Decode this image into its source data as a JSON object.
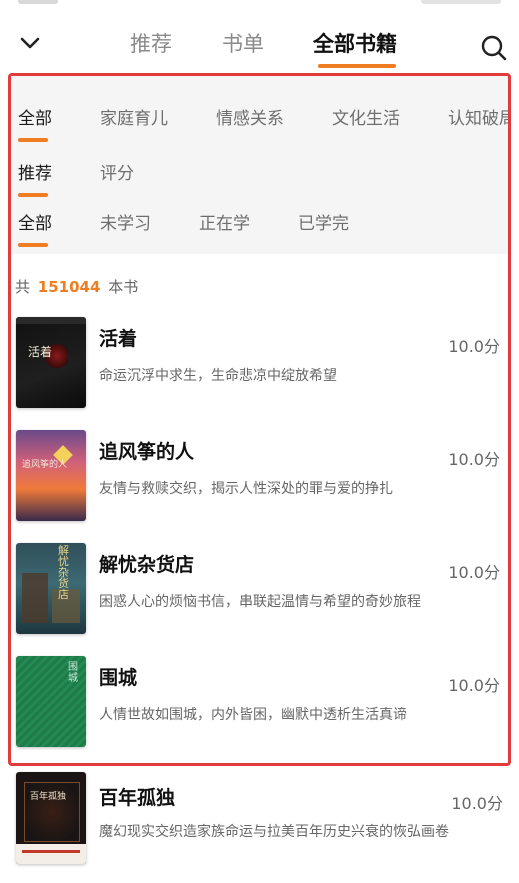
{
  "nav": {
    "tabs": [
      "推荐",
      "书单",
      "全部书籍"
    ],
    "active_tab": 2
  },
  "filters": {
    "category": [
      "全部",
      "家庭育儿",
      "情感关系",
      "文化生活",
      "认知破局"
    ],
    "sort": [
      "推荐",
      "评分"
    ],
    "progress": [
      "全部",
      "未学习",
      "正在学",
      "已学完"
    ]
  },
  "count": {
    "prefix": "共",
    "total": "151044",
    "suffix": "本书"
  },
  "books": [
    {
      "title": "活着",
      "desc": "命运沉浮中求生，生命悲凉中绽放希望",
      "score": "10.0分",
      "cover_text": "活着"
    },
    {
      "title": "追风筝的人",
      "desc": "友情与救赎交织，揭示人性深处的罪与爱的挣扎",
      "score": "10.0分",
      "cover_text": "追风筝的人"
    },
    {
      "title": "解忧杂货店",
      "desc": "困惑人心的烦恼书信，串联起温情与希望的奇妙旅程",
      "score": "10.0分",
      "cover_text": "解忧杂货店"
    },
    {
      "title": "围城",
      "desc": "人情世故如围城，内外皆困，幽默中透析生活真谛",
      "score": "10.0分",
      "cover_text": "围城"
    },
    {
      "title": "百年孤独",
      "desc": "魔幻现实交织造家族命运与拉美百年历史兴衰的恢弘画卷",
      "score": "10.0分",
      "cover_text": "百年孤独"
    }
  ],
  "colors": {
    "accent": "#ef7d21",
    "highlight_border": "#e23b3b"
  }
}
